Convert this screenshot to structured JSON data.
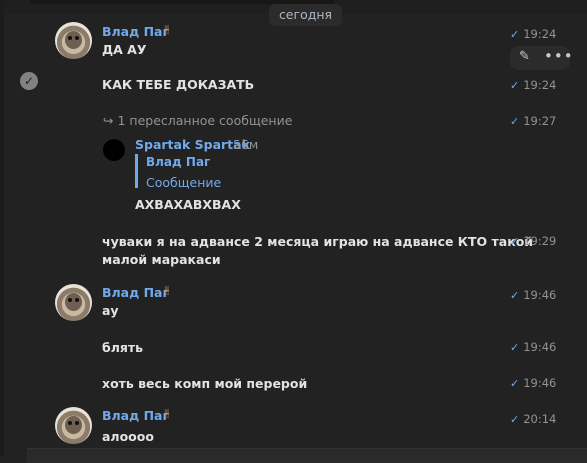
{
  "date_divider": "сегодня",
  "sender_name": "Влад Паг",
  "sender_badge": "✌",
  "messages": [
    {
      "text": "ДА АУ",
      "time": "19:24"
    },
    {
      "text": "КАК ТЕБЕ ДОКАЗАТЬ",
      "time": "19:24"
    },
    {
      "text": "чуваки я на адвансе 2 месяца играю на адвансе КТО такой",
      "text2": "малой маракаси",
      "time": "19:29"
    },
    {
      "text": "ау",
      "time": "19:46"
    },
    {
      "text": "блять",
      "time": "19:46"
    },
    {
      "text": "хоть весь комп мой перерой",
      "time": "19:46"
    },
    {
      "text": "алоооо",
      "time": "20:14"
    }
  ],
  "forward": {
    "label": "1 пересланное сообщение",
    "time": "19:27",
    "author": "Spartak Spartak",
    "ago": "56м",
    "quote_author": "Влад Паг",
    "quote_text": "Сообщение",
    "text": "АХВАХАВХВАХ"
  },
  "actions": {
    "edit_icon": "✎",
    "more_icon": "•••"
  },
  "icons": {
    "checkmark": "✓",
    "forward": "↪"
  }
}
